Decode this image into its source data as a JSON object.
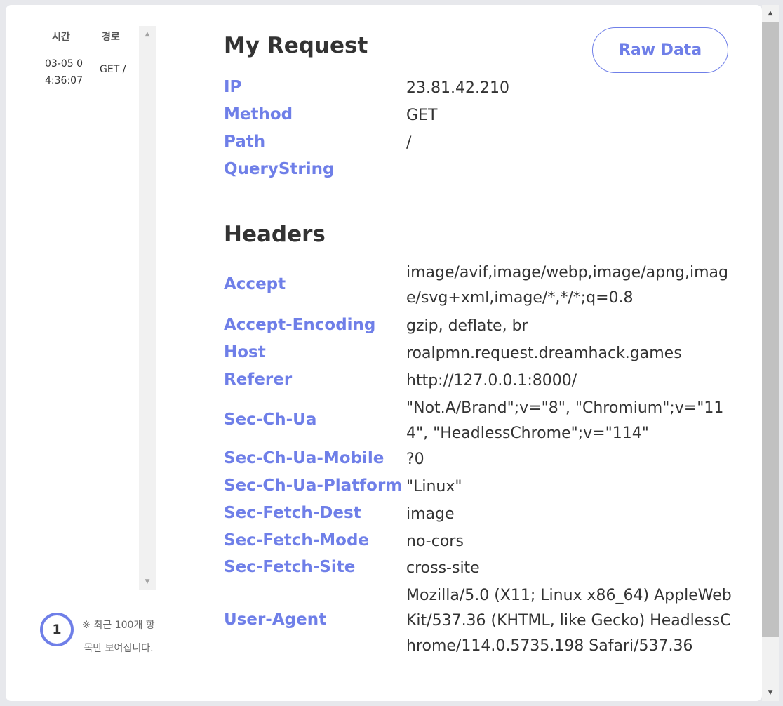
{
  "sidebar": {
    "headers": {
      "time": "시간",
      "path": "경로"
    },
    "rows": [
      {
        "time": "03-05 04:36:07",
        "path": "GET /"
      }
    ],
    "count": "1",
    "notice": "※ 최근 100개 항목만 보여집니다."
  },
  "request": {
    "title": "My Request",
    "raw_button": "Raw Data",
    "fields": [
      {
        "key": "IP",
        "value": "23.81.42.210"
      },
      {
        "key": "Method",
        "value": "GET"
      },
      {
        "key": "Path",
        "value": "/"
      },
      {
        "key": "QueryString",
        "value": ""
      }
    ]
  },
  "headers": {
    "title": "Headers",
    "items": [
      {
        "key": "Accept",
        "value": "image/avif,image/webp,image/apng,image/svg+xml,image/*,*/*;q=0.8"
      },
      {
        "key": "Accept-Encoding",
        "value": "gzip, deflate, br"
      },
      {
        "key": "Host",
        "value": "roalpmn.request.dreamhack.games"
      },
      {
        "key": "Referer",
        "value": "http://127.0.0.1:8000/"
      },
      {
        "key": "Sec-Ch-Ua",
        "value": "\"Not.A/Brand\";v=\"8\", \"Chromium\";v=\"114\", \"HeadlessChrome\";v=\"114\""
      },
      {
        "key": "Sec-Ch-Ua-Mobile",
        "value": "?0"
      },
      {
        "key": "Sec-Ch-Ua-Platform",
        "value": "\"Linux\""
      },
      {
        "key": "Sec-Fetch-Dest",
        "value": "image"
      },
      {
        "key": "Sec-Fetch-Mode",
        "value": "no-cors"
      },
      {
        "key": "Sec-Fetch-Site",
        "value": "cross-site"
      },
      {
        "key": "User-Agent",
        "value": "Mozilla/5.0 (X11; Linux x86_64) AppleWebKit/537.36 (KHTML, like Gecko) HeadlessChrome/114.0.5735.198 Safari/537.36"
      }
    ]
  },
  "icons": {
    "scroll_up": "triangle-up-icon",
    "scroll_down": "triangle-down-icon"
  },
  "colors": {
    "accent": "#6f7fe8",
    "text": "#333333",
    "background": "#e7e8ec"
  }
}
